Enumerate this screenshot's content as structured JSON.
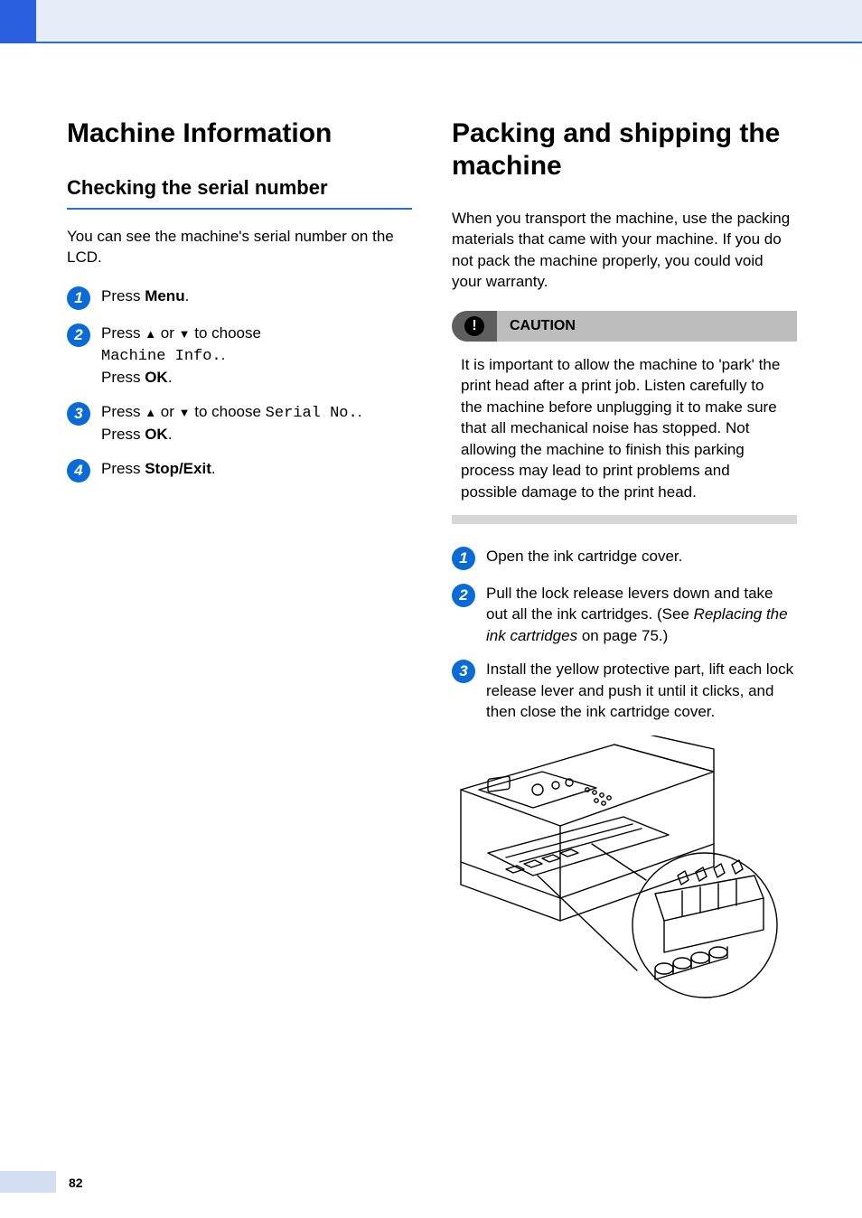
{
  "page_number": "82",
  "left": {
    "h1": "Machine Information",
    "h2": "Checking the serial number",
    "intro": "You can see the machine's serial number on the LCD.",
    "steps": {
      "s1": {
        "press": "Press ",
        "menu": "Menu",
        "dot": "."
      },
      "s2": {
        "line1a": "Press ",
        "up": "▲",
        "or": " or ",
        "down": "▼",
        "line1b": " to choose ",
        "mono": "Machine Info.",
        "dot1": ".",
        "line2a": "Press ",
        "ok": "OK",
        "dot2": "."
      },
      "s3": {
        "line1a": "Press ",
        "up": "▲",
        "or": " or ",
        "down": "▼",
        "line1b": " to choose ",
        "mono": "Serial No.",
        "dot1": ".",
        "line2a": "Press ",
        "ok": "OK",
        "dot2": "."
      },
      "s4": {
        "press": "Press ",
        "stop": "Stop/Exit",
        "dot": "."
      }
    }
  },
  "right": {
    "h1": "Packing and shipping the machine",
    "intro": "When you transport the machine, use the packing materials that came with your machine. If you do not pack the machine properly, you could void your warranty.",
    "caution": {
      "label": "CAUTION",
      "icon": "!",
      "body": "It is important to allow the machine to 'park' the print head after a print job. Listen carefully to the machine before unplugging it to make sure that all mechanical noise has stopped. Not allowing the machine to finish this parking process may lead to print problems and possible damage to the print head."
    },
    "steps": {
      "s1": "Open the ink cartridge cover.",
      "s2": {
        "a": "Pull the lock release levers down and take out all the ink cartridges. (See ",
        "link": "Replacing the ink cartridges",
        "b": " on page 75.)"
      },
      "s3": "Install the yellow protective part, lift each lock release lever and push it until it clicks, and then close the ink cartridge cover."
    }
  }
}
